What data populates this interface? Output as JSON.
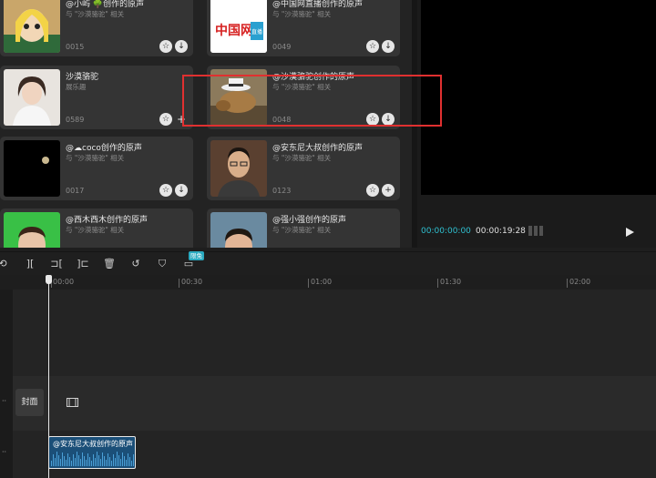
{
  "library": {
    "cards": [
      {
        "title": "@小屿 🌳创作的原声",
        "subtitle": "与 \"沙漠骆驼\" 相关",
        "count": "0015",
        "action": "download",
        "thumb": "cartoon-girl"
      },
      {
        "title": "@中国网直播创作的原声",
        "subtitle": "与 \"沙漠骆驼\" 相关",
        "count": "0049",
        "action": "download",
        "thumb": "china-logo"
      },
      {
        "title": "沙漠骆驼",
        "subtitle": "展乐趣",
        "count": "0589",
        "action": "add",
        "thumb": "woman-portrait"
      },
      {
        "title": "@沙漠骆驼创作的原声",
        "subtitle": "与 \"沙漠骆驼\" 相关",
        "count": "0048",
        "action": "download",
        "thumb": "camel-hat"
      },
      {
        "title": "@☁coco创作的原声",
        "subtitle": "与 \"沙漠骆驼\" 相关",
        "count": "0017",
        "action": "download",
        "thumb": "moon-night"
      },
      {
        "title": "@安东尼大叔创作的原声",
        "subtitle": "与 \"沙漠骆驼\" 相关",
        "count": "0123",
        "action": "add",
        "thumb": "man-glasses"
      },
      {
        "title": "@西木西木创作的原声",
        "subtitle": "与 \"沙漠骆驼\" 相关",
        "count": "",
        "action": "",
        "thumb": "green-man"
      },
      {
        "title": "@强小强创作的原声",
        "subtitle": "与 \"沙漠骆驼\" 相关",
        "count": "",
        "action": "",
        "thumb": "boy"
      }
    ],
    "logo_text": "中国网",
    "logo_tag": "直播"
  },
  "player": {
    "current_time": "00:00:00:00",
    "total_time": "00:00:19:28"
  },
  "toolbar": {
    "badge": "限免"
  },
  "ruler": {
    "ticks": [
      "00:00",
      "00:30",
      "01:00",
      "01:30",
      "02:00"
    ]
  },
  "timeline": {
    "cover_label": "封面",
    "clip_label": "@安东尼大叔创作的原声"
  },
  "colors": {
    "accent": "#2fc0d0",
    "highlight": "#e03030",
    "clip": "#1b4f78"
  }
}
